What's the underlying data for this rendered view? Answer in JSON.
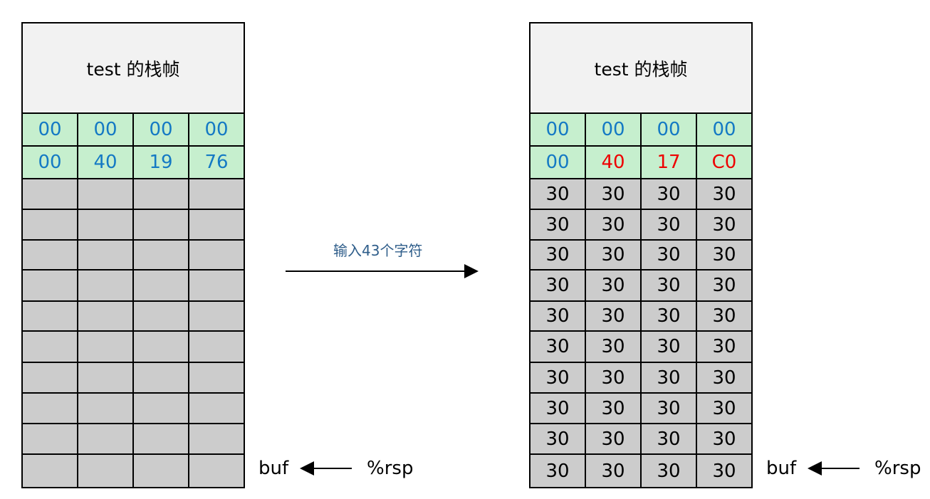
{
  "left_stack": {
    "header": "test 的栈帧",
    "rows": [
      [
        "00",
        "00",
        "00",
        "00"
      ],
      [
        "00",
        "40",
        "19",
        "76"
      ]
    ],
    "empty_rows": 10,
    "buf_label": "buf",
    "rsp_label": "%rsp"
  },
  "arrow_label": "输入43个字符",
  "right_stack": {
    "header": "test 的栈帧",
    "rows": [
      [
        "00",
        "00",
        "00",
        "00"
      ],
      [
        "00",
        "40",
        "17",
        "C0"
      ]
    ],
    "fill_rows": [
      [
        "30",
        "30",
        "30",
        "30"
      ],
      [
        "30",
        "30",
        "30",
        "30"
      ],
      [
        "30",
        "30",
        "30",
        "30"
      ],
      [
        "30",
        "30",
        "30",
        "30"
      ],
      [
        "30",
        "30",
        "30",
        "30"
      ],
      [
        "30",
        "30",
        "30",
        "30"
      ],
      [
        "30",
        "30",
        "30",
        "30"
      ],
      [
        "30",
        "30",
        "30",
        "30"
      ],
      [
        "30",
        "30",
        "30",
        "30"
      ],
      [
        "30",
        "30",
        "30",
        "30"
      ]
    ],
    "buf_label": "buf",
    "rsp_label": "%rsp"
  },
  "colors": {
    "green_cell": "#c6efce",
    "gray_cell": "#cccccc",
    "blue_text": "#1479c4",
    "red_text": "#ee0000"
  }
}
